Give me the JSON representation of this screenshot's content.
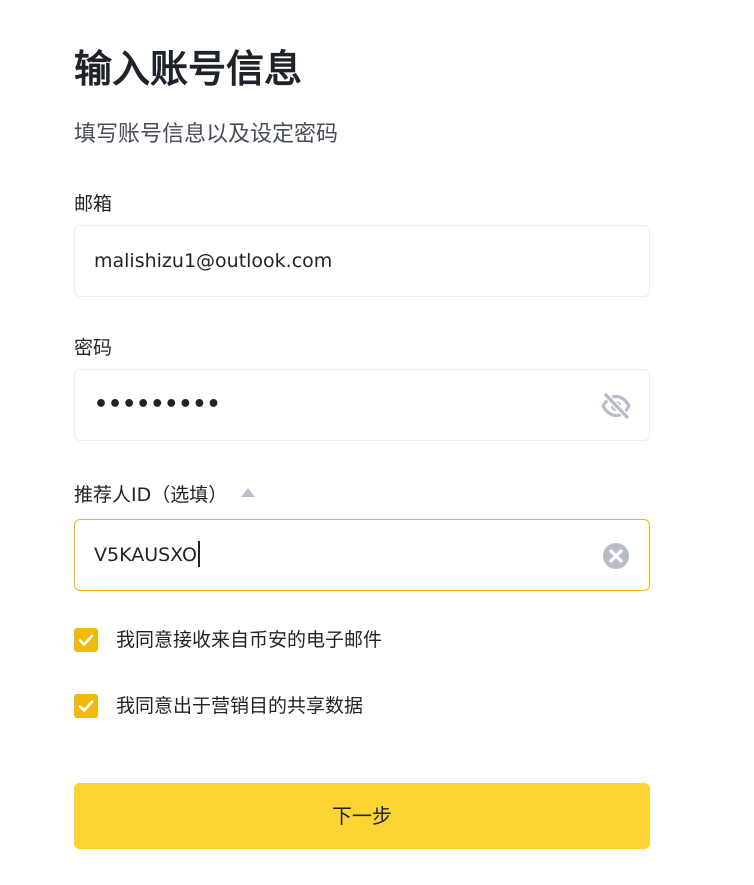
{
  "page": {
    "title": "输入账号信息",
    "subtitle": "填写账号信息以及设定密码"
  },
  "form": {
    "email": {
      "label": "邮箱",
      "value": "malishizu1@outlook.com"
    },
    "password": {
      "label": "密码",
      "masked_value": "•••••••••",
      "visibility_icon": "eye-slash-icon"
    },
    "referrer": {
      "label": "推荐人ID（选填）",
      "value": "V5KAUSXO",
      "toggle_icon": "caret-up-icon",
      "clear_icon": "clear-circle-icon",
      "expanded": true
    },
    "consents": [
      {
        "label": "我同意接收来自币安的电子邮件",
        "checked": true
      },
      {
        "label": "我同意出于营销目的共享数据",
        "checked": true
      }
    ],
    "submit_label": "下一步"
  },
  "colors": {
    "accent": "#f0b90b",
    "button": "#fcd535",
    "text": "#1e2329",
    "muted_icon": "#b7bdc6",
    "border": "#eaecef"
  }
}
